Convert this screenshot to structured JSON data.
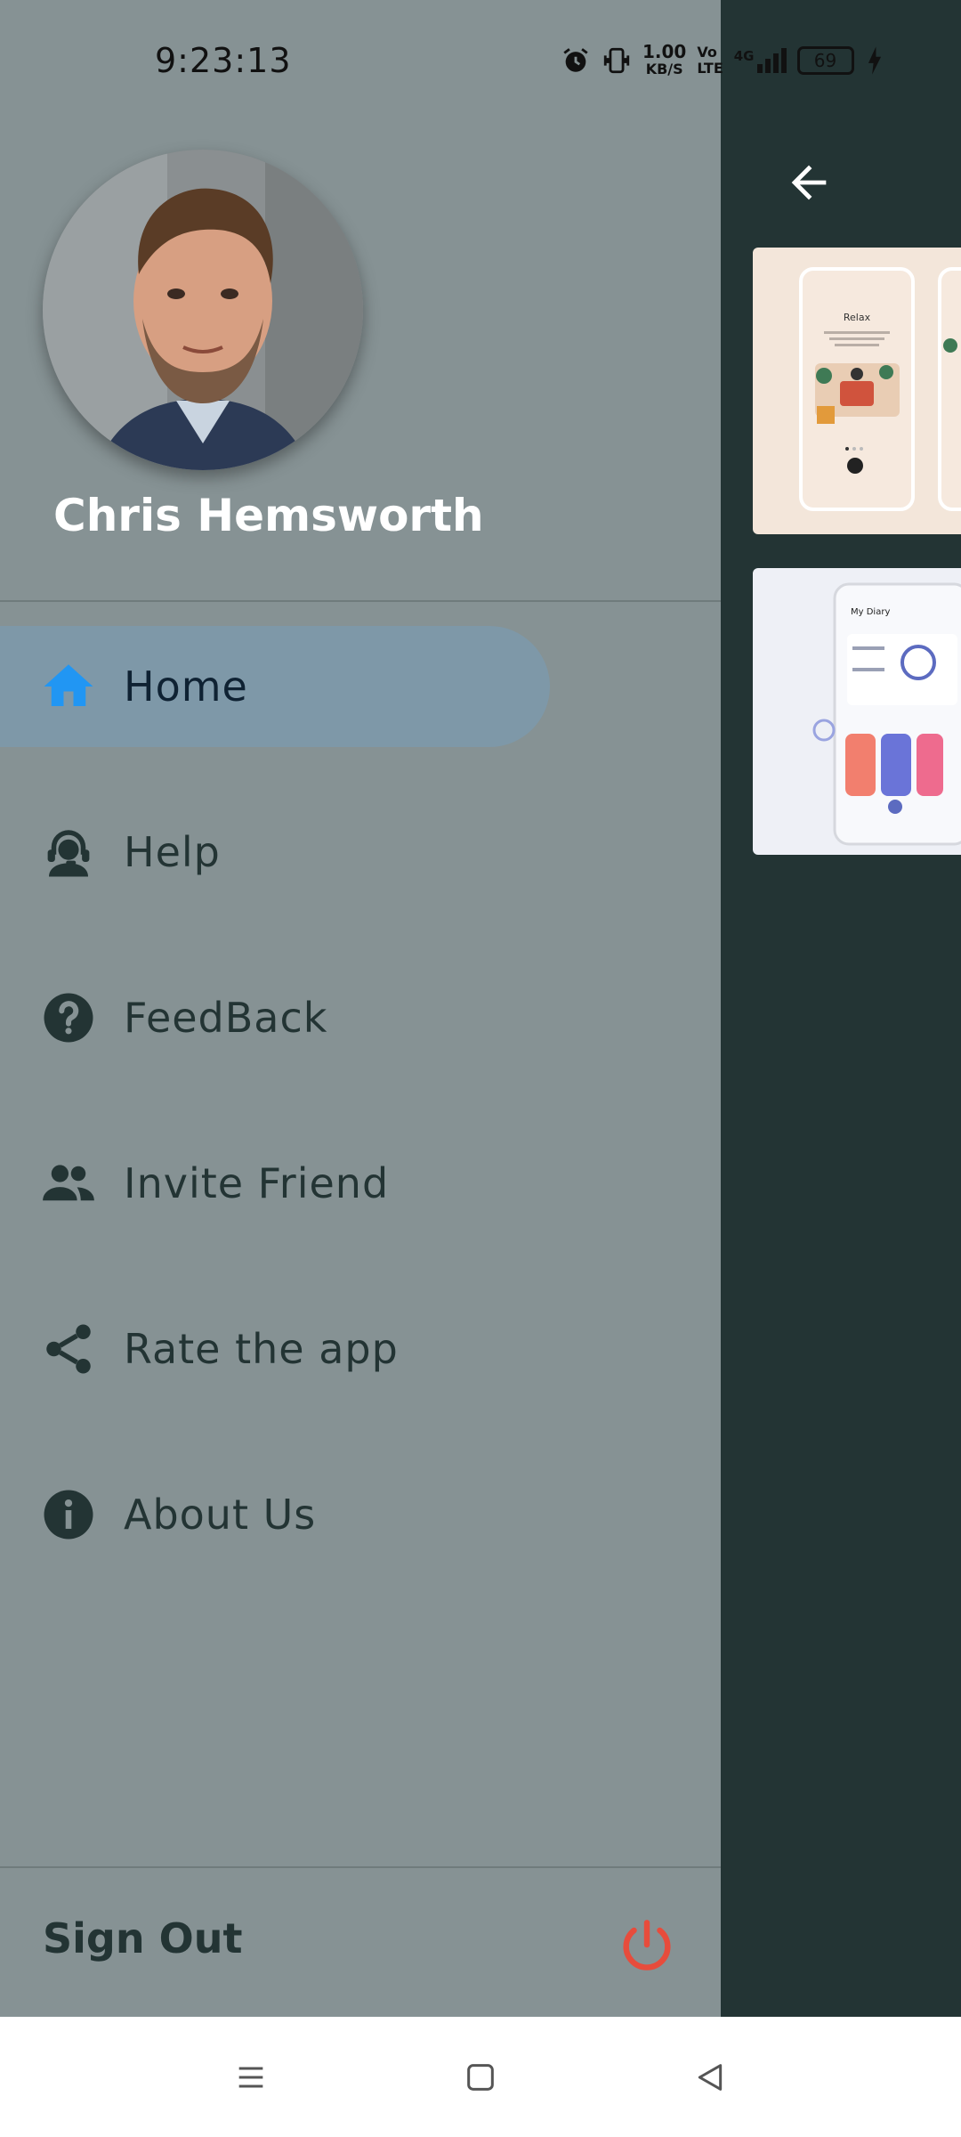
{
  "status_bar": {
    "time": "9:23:13",
    "net_speed_value": "1.00",
    "net_speed_unit": "KB/S",
    "volte_top": "Vo",
    "volte_bottom": "LTE",
    "network": "4G",
    "battery": "69"
  },
  "profile": {
    "name": "Chris Hemsworth"
  },
  "menu": {
    "items": [
      {
        "label": "Home",
        "icon": "home-icon",
        "active": true
      },
      {
        "label": "Help",
        "icon": "support-agent-icon"
      },
      {
        "label": "FeedBack",
        "icon": "help-circle-icon"
      },
      {
        "label": "Invite Friend",
        "icon": "people-icon"
      },
      {
        "label": "Rate the app",
        "icon": "share-icon"
      },
      {
        "label": "About Us",
        "icon": "info-icon"
      }
    ]
  },
  "footer": {
    "signout_label": "Sign Out",
    "power_icon": "power-icon"
  },
  "content_preview": {
    "back_icon": "arrow-back-icon",
    "card1_title": "Relax",
    "card2_title": "My Diary"
  },
  "colors": {
    "drawer_bg": "#869294",
    "active_item_bg": "#7e98a8",
    "home_icon": "#2196f3",
    "power_icon": "#e74c3c",
    "right_panel_bg": "#233434"
  }
}
